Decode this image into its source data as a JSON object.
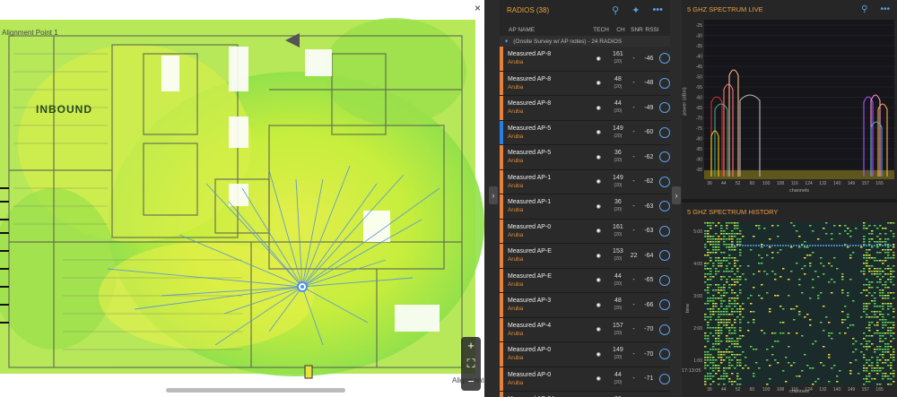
{
  "map": {
    "close_icon": "×",
    "alignment_label_1": "Alignment Point 1",
    "alignment_label_2": "Alignment",
    "area_label_inbound": "INBOUND",
    "zoom_in": "+",
    "fit": "⛶",
    "zoom_out": "−"
  },
  "radios": {
    "title": "RADIOS (38)",
    "columns": {
      "name": "AP NAME",
      "tech": "TECH",
      "ch": "CH",
      "snr": "SNR",
      "rssi": "RSSI"
    },
    "group_label": "(Onsite Survey w/ AP notes) - 24 RADIOS",
    "rows": [
      {
        "name": "Measured AP-8",
        "vendor": "Aruba",
        "ch": "161",
        "width": "(20)",
        "snr": "-",
        "rssi": "-46",
        "color": "#e8823a"
      },
      {
        "name": "Measured AP-8",
        "vendor": "Aruba",
        "ch": "48",
        "width": "(20)",
        "snr": "-",
        "rssi": "-48",
        "color": "#e8823a"
      },
      {
        "name": "Measured AP-8",
        "vendor": "Aruba",
        "ch": "44",
        "width": "(20)",
        "snr": "-",
        "rssi": "-49",
        "color": "#e8823a"
      },
      {
        "name": "Measured AP-5",
        "vendor": "Aruba",
        "ch": "149",
        "width": "(20)",
        "snr": "-",
        "rssi": "-60",
        "color": "#2a7de1"
      },
      {
        "name": "Measured AP-5",
        "vendor": "Aruba",
        "ch": "36",
        "width": "(20)",
        "snr": "-",
        "rssi": "-62",
        "color": "#e8823a"
      },
      {
        "name": "Measured AP-1",
        "vendor": "Aruba",
        "ch": "149",
        "width": "(20)",
        "snr": "-",
        "rssi": "-62",
        "color": "#e8823a"
      },
      {
        "name": "Measured AP-1",
        "vendor": "Aruba",
        "ch": "36",
        "width": "(20)",
        "snr": "-",
        "rssi": "-63",
        "color": "#e8823a"
      },
      {
        "name": "Measured AP-0",
        "vendor": "Aruba",
        "ch": "161",
        "width": "(20)",
        "snr": "-",
        "rssi": "-63",
        "color": "#e8823a"
      },
      {
        "name": "Measured AP-E",
        "vendor": "Aruba",
        "ch": "153",
        "width": "(20)",
        "snr": "22",
        "rssi": "-64",
        "color": "#e8823a"
      },
      {
        "name": "Measured AP-E",
        "vendor": "Aruba",
        "ch": "44",
        "width": "(20)",
        "snr": "-",
        "rssi": "-65",
        "color": "#e8823a"
      },
      {
        "name": "Measured AP-3",
        "vendor": "Aruba",
        "ch": "48",
        "width": "(20)",
        "snr": "-",
        "rssi": "-66",
        "color": "#e8823a"
      },
      {
        "name": "Measured AP-4",
        "vendor": "Aruba",
        "ch": "157",
        "width": "(20)",
        "snr": "-",
        "rssi": "-70",
        "color": "#e8823a"
      },
      {
        "name": "Measured AP-0",
        "vendor": "Aruba",
        "ch": "149",
        "width": "(20)",
        "snr": "-",
        "rssi": "-70",
        "color": "#e8823a"
      },
      {
        "name": "Measured AP-0",
        "vendor": "Aruba",
        "ch": "44",
        "width": "(20)",
        "snr": "-",
        "rssi": "-71",
        "color": "#e8823a"
      },
      {
        "name": "Measured AP-04",
        "vendor": "Aruba",
        "ch": "36",
        "width": "(20)",
        "snr": "-",
        "rssi": "-72",
        "color": "#e8823a"
      }
    ]
  },
  "spectrum_live": {
    "title": "5 GHZ SPECTRUM LIVE",
    "ylabel": "power (dBm)",
    "xlabel": "channels",
    "y_ticks": [
      "-25",
      "-30",
      "-35",
      "-40",
      "-45",
      "-50",
      "-55",
      "-60",
      "-65",
      "-70",
      "-75",
      "-80",
      "-85",
      "-90",
      "-95"
    ],
    "x_ticks": [
      "36",
      "44",
      "52",
      "60",
      "100",
      "108",
      "116",
      "124",
      "132",
      "140",
      "149",
      "157",
      "165"
    ]
  },
  "spectrum_history": {
    "title": "5 GHZ SPECTRUM HISTORY",
    "ylabel": "time",
    "xlabel": "channels",
    "y_ticks": [
      "5:00",
      "4:00",
      "3:00",
      "2:00",
      "1:00"
    ],
    "time_label": "17:13:05",
    "x_ticks": [
      "36",
      "44",
      "52",
      "60",
      "100",
      "108",
      "116",
      "124",
      "132",
      "140",
      "149",
      "157",
      "165"
    ]
  },
  "icons": {
    "search": "search-icon",
    "wand": "wand-icon",
    "more": "more-icon",
    "zoom": "magnifier-icon"
  }
}
